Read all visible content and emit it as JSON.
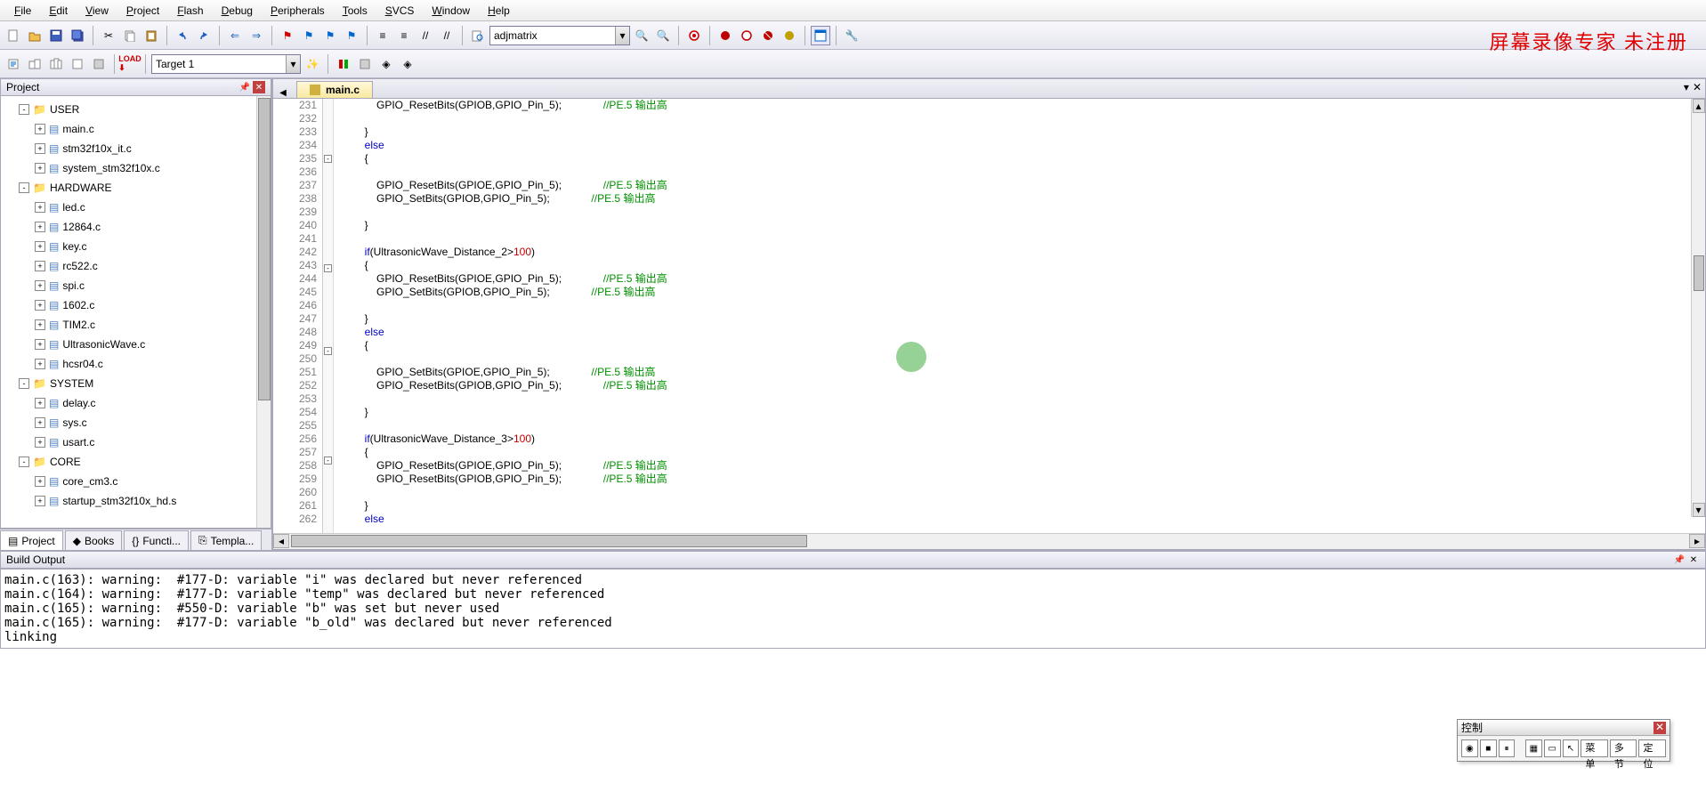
{
  "menu": [
    "File",
    "Edit",
    "View",
    "Project",
    "Flash",
    "Debug",
    "Peripherals",
    "Tools",
    "SVCS",
    "Window",
    "Help"
  ],
  "toolbar1": {
    "search_value": "adjmatrix"
  },
  "toolbar2": {
    "target_value": "Target 1"
  },
  "watermark": "屏幕录像专家  未注册",
  "project_pane": {
    "title": "Project",
    "tree": [
      {
        "d": 1,
        "exp": "-",
        "type": "folder",
        "label": "USER"
      },
      {
        "d": 2,
        "exp": "+",
        "type": "file",
        "label": "main.c"
      },
      {
        "d": 2,
        "exp": "+",
        "type": "file",
        "label": "stm32f10x_it.c"
      },
      {
        "d": 2,
        "exp": "+",
        "type": "file",
        "label": "system_stm32f10x.c"
      },
      {
        "d": 1,
        "exp": "-",
        "type": "folder",
        "label": "HARDWARE"
      },
      {
        "d": 2,
        "exp": "+",
        "type": "file",
        "label": "led.c"
      },
      {
        "d": 2,
        "exp": "+",
        "type": "file",
        "label": "12864.c"
      },
      {
        "d": 2,
        "exp": "+",
        "type": "file",
        "label": "key.c"
      },
      {
        "d": 2,
        "exp": "+",
        "type": "file",
        "label": "rc522.c"
      },
      {
        "d": 2,
        "exp": "+",
        "type": "file",
        "label": "spi.c"
      },
      {
        "d": 2,
        "exp": "+",
        "type": "file",
        "label": "1602.c"
      },
      {
        "d": 2,
        "exp": "+",
        "type": "file",
        "label": "TIM2.c"
      },
      {
        "d": 2,
        "exp": "+",
        "type": "file",
        "label": "UltrasonicWave.c"
      },
      {
        "d": 2,
        "exp": "+",
        "type": "file",
        "label": "hcsr04.c"
      },
      {
        "d": 1,
        "exp": "-",
        "type": "folder",
        "label": "SYSTEM"
      },
      {
        "d": 2,
        "exp": "+",
        "type": "file",
        "label": "delay.c"
      },
      {
        "d": 2,
        "exp": "+",
        "type": "file",
        "label": "sys.c"
      },
      {
        "d": 2,
        "exp": "+",
        "type": "file",
        "label": "usart.c"
      },
      {
        "d": 1,
        "exp": "-",
        "type": "folder",
        "label": "CORE"
      },
      {
        "d": 2,
        "exp": "+",
        "type": "file",
        "label": "core_cm3.c"
      },
      {
        "d": 2,
        "exp": "+",
        "type": "file",
        "label": "startup_stm32f10x_hd.s"
      }
    ],
    "tabs": [
      "Project",
      "Books",
      "Functi...",
      "Templa..."
    ]
  },
  "editor": {
    "tab": "main.c",
    "first_line": 231,
    "lines": [
      {
        "t": "            GPIO_ResetBits(GPIOB,GPIO_Pin_5);",
        "c": "//PE.5 输出高",
        "cpad": 14
      },
      {
        "t": ""
      },
      {
        "t": "        }"
      },
      {
        "t": "        ",
        "kw": "else"
      },
      {
        "t": "        {",
        "fold": "-"
      },
      {
        "t": ""
      },
      {
        "t": "            GPIO_ResetBits(GPIOE,GPIO_Pin_5);",
        "c": "//PE.5 输出高",
        "cpad": 14
      },
      {
        "t": "            GPIO_SetBits(GPIOB,GPIO_Pin_5);",
        "c": "//PE.5 输出高",
        "cpad": 14
      },
      {
        "t": ""
      },
      {
        "t": "        }"
      },
      {
        "t": ""
      },
      {
        "t": "        ",
        "kw": "if",
        "t2": "(UltrasonicWave_Distance_2>",
        "num": "100",
        "t3": ")"
      },
      {
        "t": "        {",
        "fold": "-"
      },
      {
        "t": "            GPIO_ResetBits(GPIOE,GPIO_Pin_5);",
        "c": "//PE.5 输出高",
        "cpad": 14
      },
      {
        "t": "            GPIO_SetBits(GPIOB,GPIO_Pin_5);",
        "c": "//PE.5 输出高",
        "cpad": 14
      },
      {
        "t": ""
      },
      {
        "t": "        }"
      },
      {
        "t": "        ",
        "kw": "else"
      },
      {
        "t": "        {",
        "fold": "-"
      },
      {
        "t": ""
      },
      {
        "t": "            GPIO_SetBits(GPIOE,GPIO_Pin_5);",
        "c": "//PE.5 输出高",
        "cpad": 14
      },
      {
        "t": "            GPIO_ResetBits(GPIOB,GPIO_Pin_5);",
        "c": "//PE.5 输出高",
        "cpad": 14
      },
      {
        "t": ""
      },
      {
        "t": "        }"
      },
      {
        "t": ""
      },
      {
        "t": "        ",
        "kw": "if",
        "t2": "(UltrasonicWave_Distance_3>",
        "num": "100",
        "t3": ")"
      },
      {
        "t": "        {",
        "fold": "-"
      },
      {
        "t": "            GPIO_ResetBits(GPIOE,GPIO_Pin_5);",
        "c": "//PE.5 输出高",
        "cpad": 14
      },
      {
        "t": "            GPIO_ResetBits(GPIOB,GPIO_Pin_5);",
        "c": "//PE.5 输出高",
        "cpad": 14
      },
      {
        "t": ""
      },
      {
        "t": "        }"
      },
      {
        "t": "        ",
        "kw": "else"
      }
    ]
  },
  "build": {
    "title": "Build Output",
    "lines": [
      "main.c(163): warning:  #177-D: variable \"i\" was declared but never referenced",
      "main.c(164): warning:  #177-D: variable \"temp\" was declared but never referenced",
      "main.c(165): warning:  #550-D: variable \"b\" was set but never used",
      "main.c(165): warning:  #177-D: variable \"b_old\" was declared but never referenced",
      "linking"
    ]
  },
  "ctrl_panel": {
    "title": "控制",
    "buttons": [
      "菜单",
      "多节",
      "定位"
    ]
  }
}
